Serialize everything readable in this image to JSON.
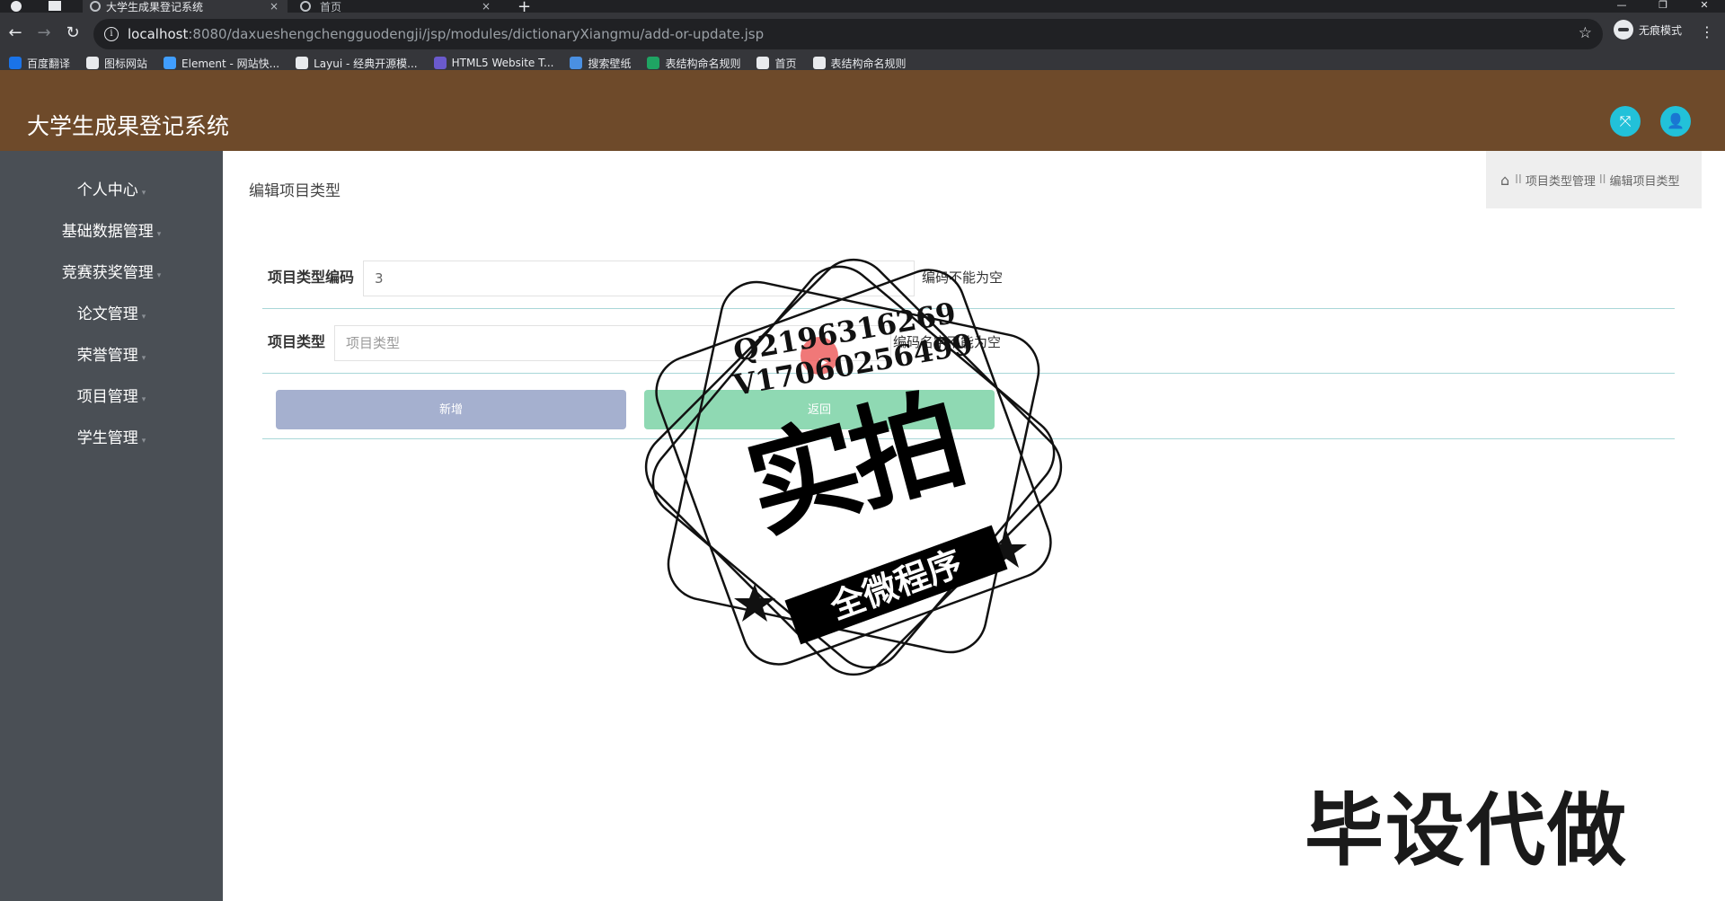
{
  "browser": {
    "active_tab_title": "大学生成果登记系统",
    "inactive_tab_title": "首页",
    "new_tab_symbol": "+",
    "tab_close_symbol": "×",
    "url_host": "localhost",
    "url_rest": ":8080/daxueshengchengguodengji/jsp/modules/dictionaryXiangmu/add-or-update.jsp",
    "incognito_label": "无痕模式",
    "bookmarks": [
      {
        "label": "百度翻译",
        "icon": "translate-icon",
        "color": "#1a73e8"
      },
      {
        "label": "图标网站",
        "icon": "flag-icon",
        "color": "#e8eaed"
      },
      {
        "label": "Element - 网站快...",
        "icon": "element-icon",
        "color": "#409eff"
      },
      {
        "label": "Layui - 经典开源模...",
        "icon": "layui-icon",
        "color": "#e8eaed"
      },
      {
        "label": "HTML5 Website T...",
        "icon": "html5-icon",
        "color": "#6a5acd"
      },
      {
        "label": "搜索壁纸",
        "icon": "wallpaper-icon",
        "color": "#4a90e2"
      },
      {
        "label": "表结构命名规则",
        "icon": "sheet-icon",
        "color": "#1fa463"
      },
      {
        "label": "首页",
        "icon": "globe-icon",
        "color": "#e8eaed"
      },
      {
        "label": "表结构命名规则",
        "icon": "globe-icon",
        "color": "#e8eaed"
      }
    ]
  },
  "app": {
    "title": "大学生成果登记系统",
    "header_color": "#6e4a2a",
    "accent_color": "#22c1d9"
  },
  "sidebar": {
    "items": [
      {
        "label": "个人中心"
      },
      {
        "label": "基础数据管理"
      },
      {
        "label": "竞赛获奖管理"
      },
      {
        "label": "论文管理"
      },
      {
        "label": "荣誉管理"
      },
      {
        "label": "项目管理"
      },
      {
        "label": "学生管理"
      }
    ]
  },
  "main": {
    "heading": "编辑项目类型",
    "breadcrumb": {
      "separator": "II",
      "parent": "项目类型管理",
      "current": "编辑项目类型"
    },
    "form": {
      "code_label": "项目类型编码",
      "code_value": "3",
      "code_error": "编码不能为空",
      "name_label": "项目类型",
      "name_placeholder": "项目类型",
      "name_error": "编码名字不能为空"
    },
    "buttons": {
      "add": "新增",
      "back": "返回"
    }
  },
  "overlay": {
    "qq": "Q2196316269",
    "vx": "V17060256499",
    "stamp_main": "实拍",
    "stamp_banner": "全微程序",
    "corner_text": "毕设代做"
  }
}
